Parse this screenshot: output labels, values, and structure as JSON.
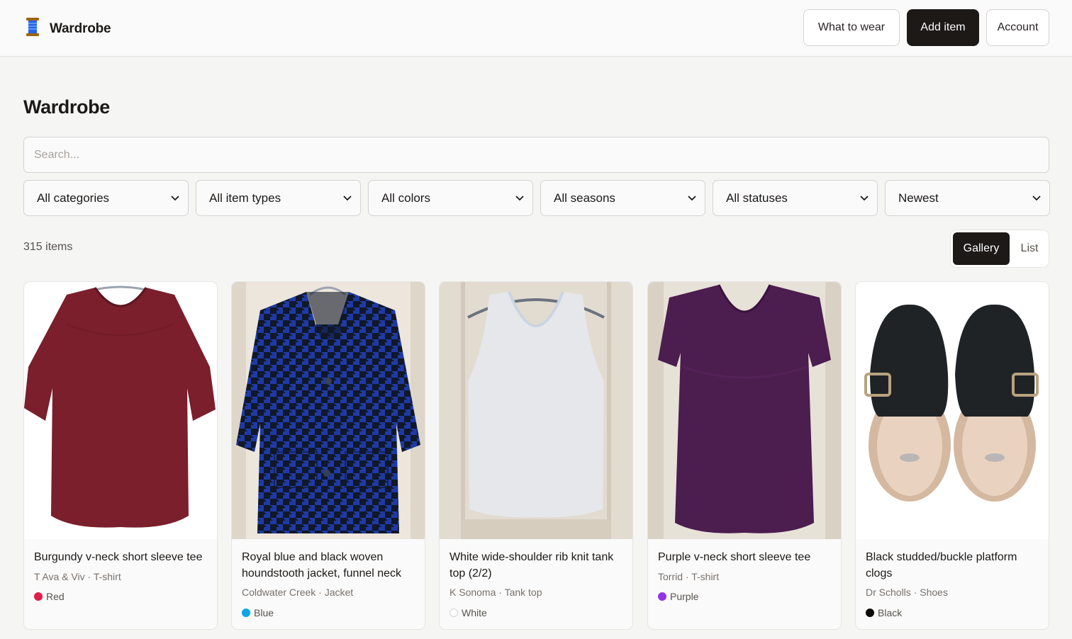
{
  "app": {
    "title": "Wardrobe",
    "icon": "spool-icon"
  },
  "nav": {
    "what_to_wear": "What to wear",
    "add_item": "Add item",
    "account": "Account"
  },
  "page": {
    "title": "Wardrobe"
  },
  "search": {
    "placeholder": "Search..."
  },
  "filters": {
    "category": "All categories",
    "item_type": "All item types",
    "color": "All colors",
    "season": "All seasons",
    "status": "All statuses",
    "sort": "Newest"
  },
  "results": {
    "count": "315 items"
  },
  "view_toggle": {
    "gallery": "Gallery",
    "list": "List",
    "selected": "Gallery"
  },
  "items": [
    {
      "title": "Burgundy v-neck short sleeve tee",
      "brand": "T Ava & Viv",
      "type": "T-shirt",
      "color_name": "Red",
      "color_hex": "#e11d48"
    },
    {
      "title": "Royal blue and black woven houndstooth jacket, funnel neck",
      "brand": "Coldwater Creek",
      "type": "Jacket",
      "color_name": "Blue",
      "color_hex": "#0ea5e9"
    },
    {
      "title": "White wide-shoulder rib knit tank top (2/2)",
      "brand": "K Sonoma",
      "type": "Tank top",
      "color_name": "White",
      "color_hex": "#ffffff"
    },
    {
      "title": "Purple v-neck short sleeve tee",
      "brand": "Torrid",
      "type": "T-shirt",
      "color_name": "Purple",
      "color_hex": "#9333ea"
    },
    {
      "title": "Black studded/buckle platform clogs",
      "brand": "Dr Scholls",
      "type": "Shoes",
      "color_name": "Black",
      "color_hex": "#0c0a09"
    }
  ]
}
